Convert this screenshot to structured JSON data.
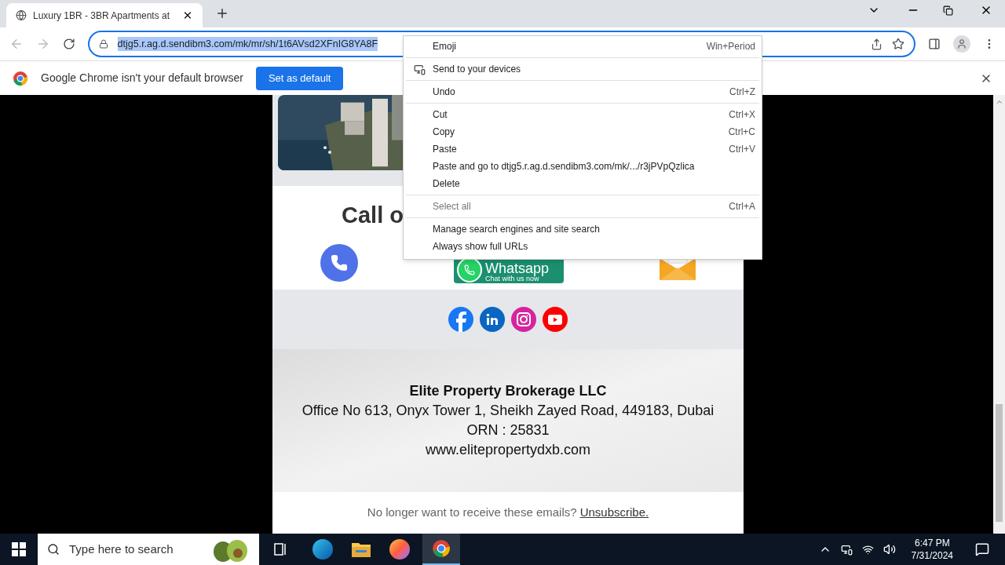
{
  "tab": {
    "title": "Luxury 1BR - 3BR Apartments at",
    "selected": true
  },
  "address_bar": {
    "url": "dtjg5.r.ag.d.sendibm3.com/mk/mr/sh/1t6AVsd2XFnIG8YA8F"
  },
  "infobar": {
    "message": "Google Chrome isn't your default browser",
    "button": "Set as default"
  },
  "email": {
    "heading": "Call o",
    "whatsapp": {
      "title": "Whatsapp",
      "subtitle": "Chat with us now"
    },
    "footer": {
      "company": "Elite Property Brokerage LLC",
      "address": "Office No 613, Onyx Tower 1, Sheikh Zayed Road, 449183, Dubai",
      "orn": "ORN : 25831",
      "website": "www.elitepropertydxb.com"
    },
    "unsubscribe": {
      "text": "No longer want to receive these emails?",
      "link": "Unsubscribe."
    }
  },
  "context_menu": [
    [
      {
        "kind": "plain",
        "label": "Emoji",
        "shortcut": "Win+Period",
        "disabled": false
      }
    ],
    [
      {
        "kind": "device",
        "label": "Send to your devices",
        "disabled": false
      }
    ],
    [
      {
        "kind": "plain",
        "label": "Undo",
        "shortcut": "Ctrl+Z",
        "disabled": false
      }
    ],
    [
      {
        "kind": "plain",
        "label": "Cut",
        "shortcut": "Ctrl+X",
        "disabled": false
      },
      {
        "kind": "plain",
        "label": "Copy",
        "shortcut": "Ctrl+C",
        "disabled": false
      },
      {
        "kind": "plain",
        "label": "Paste",
        "shortcut": "Ctrl+V",
        "disabled": false
      },
      {
        "kind": "plain",
        "label": "Paste and go to dtjg5.r.ag.d.sendibm3.com/mk/.../r3jPVpQzlica",
        "disabled": false
      },
      {
        "kind": "plain",
        "label": "Delete",
        "disabled": false
      }
    ],
    [
      {
        "kind": "plain",
        "label": "Select all",
        "shortcut": "Ctrl+A",
        "disabled": true
      }
    ],
    [
      {
        "kind": "plain",
        "label": "Manage search engines and site search",
        "disabled": false
      },
      {
        "kind": "plain",
        "label": "Always show full URLs",
        "disabled": false
      }
    ]
  ],
  "taskbar": {
    "search_placeholder": "Type here to search",
    "time": "6:47 PM",
    "date": "7/31/2024"
  }
}
